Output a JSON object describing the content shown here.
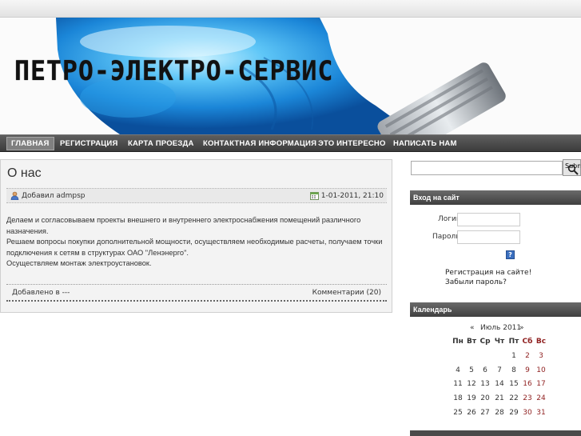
{
  "site": {
    "title": "ПЕТРО-ЭЛЕКТРО-СЕРВИС"
  },
  "nav": [
    {
      "label": "ГЛАВНАЯ"
    },
    {
      "label": "РЕГИСТРАЦИЯ"
    },
    {
      "label": "КАРТА ПРОЕЗДА"
    },
    {
      "label": "КОНТАКТНАЯ ИНФОРМАЦИЯ"
    },
    {
      "label": "ЭТО ИНТЕРЕСНО"
    },
    {
      "label": "НАПИСАТЬ НАМ"
    }
  ],
  "article": {
    "title": "О нас",
    "author": "Добавил admpsp",
    "date": "1-01-2011, 21:10",
    "paragraphs": [
      "Делаем и согласовываем проекты внешнего и внутреннего электроснабжения помещений различного назначения.",
      "Решаем вопросы покупки дополнительной мощности, осуществляем необходимые расчеты, получаем точки подключения к сетям в структурах ОАО \"Ленэнерго\".",
      "Осуществляем монтаж электроустановок."
    ],
    "added_in": "Добавлено в ---",
    "comments": "Комментарии (20)"
  },
  "search": {
    "value": "",
    "button_label": "Submit"
  },
  "login": {
    "header": "Вход на сайт",
    "login_label": "Логин",
    "password_label": "Пароль",
    "help_icon": "?",
    "register_link": "Регистрация на сайте!",
    "forgot_link": "Забыли пароль?"
  },
  "calendar": {
    "header": "Календарь",
    "prev": "«",
    "next": "»",
    "month": "Июль 2011",
    "weekdays": [
      "Пн",
      "Вт",
      "Ср",
      "Чт",
      "Пт",
      "Сб",
      "Вс"
    ],
    "weeks": [
      [
        "",
        "",
        "",
        "",
        "1",
        "2",
        "3"
      ],
      [
        "4",
        "5",
        "6",
        "7",
        "8",
        "9",
        "10"
      ],
      [
        "11",
        "12",
        "13",
        "14",
        "15",
        "16",
        "17"
      ],
      [
        "18",
        "19",
        "20",
        "21",
        "22",
        "23",
        "24"
      ],
      [
        "25",
        "26",
        "27",
        "28",
        "29",
        "30",
        "31"
      ]
    ],
    "weekend_color": "#8f1f1f"
  },
  "icons": {
    "author": "user-icon",
    "date": "calendar-icon",
    "search": "magnifier-icon"
  }
}
